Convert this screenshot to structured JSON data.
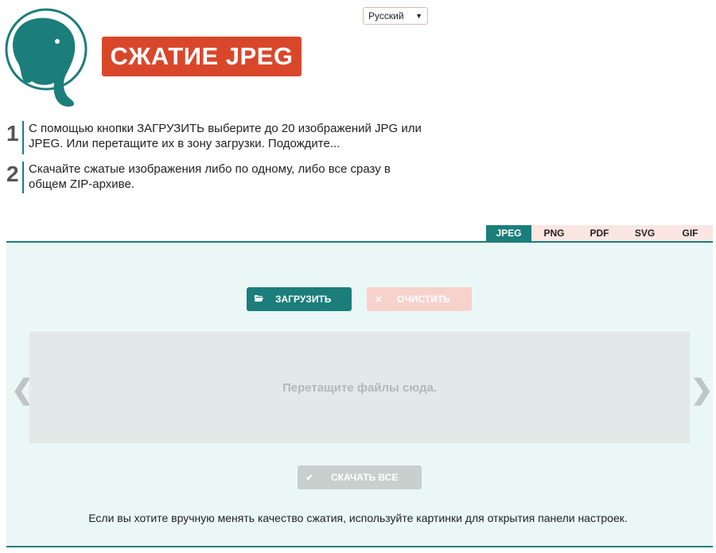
{
  "header": {
    "logo_icon": "elephant-logo-icon",
    "title": "СЖАТИЕ JPEG",
    "language": "Русский"
  },
  "steps": [
    {
      "number": "1",
      "text": "С помощью кнопки ЗАГРУЗИТЬ выберите до 20 изображений JPG или JPEG. Или перетащите их в зону загрузки. Подождите..."
    },
    {
      "number": "2",
      "text": "Скачайте сжатые изображения либо по одному, либо все сразу в общем ZIP-архиве."
    }
  ],
  "tabs": [
    {
      "label": "JPEG",
      "active": true
    },
    {
      "label": "PNG",
      "active": false
    },
    {
      "label": "PDF",
      "active": false
    },
    {
      "label": "SVG",
      "active": false
    },
    {
      "label": "GIF",
      "active": false
    }
  ],
  "buttons": {
    "upload_label": "ЗАГРУЗИТЬ",
    "clear_label": "ОЧИСТИТЬ",
    "download_all_label": "СКАЧАТЬ ВСЕ"
  },
  "dropzone": {
    "text": "Перетащите файлы сюда."
  },
  "hint": "Если вы хотите вручную менять качество сжатия, используйте картинки для открытия панели настроек.",
  "colors": {
    "accent": "#1b7e7b",
    "brand_red": "#d9472b",
    "panel_bg": "#ebf7f6"
  }
}
